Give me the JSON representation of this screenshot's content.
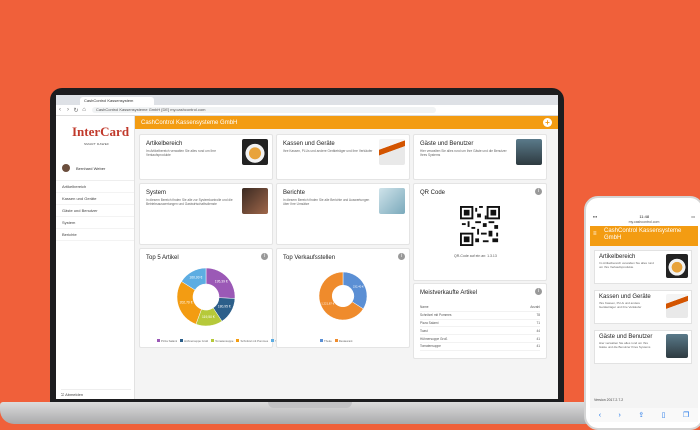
{
  "browser": {
    "tab_title": "CashControl Kassensystem",
    "url": "CashControl Kassensysteme GmbH [DE]   my.cashcontrol.com"
  },
  "sidebar": {
    "logo_main": "InterCard",
    "logo_sub": "SMART DAWEF",
    "user_name": "Bernhard Weber",
    "items": [
      {
        "label": "Artikelbereich"
      },
      {
        "label": "Kassen und Geräte"
      },
      {
        "label": "Gäste und Benutzer"
      },
      {
        "label": "System"
      },
      {
        "label": "Berichte"
      }
    ],
    "logout": "Abmelden"
  },
  "header": {
    "title": "CashControl Kassensysteme GmbH",
    "add": "+"
  },
  "cards": [
    {
      "title": "Artikelbereich",
      "text": "Im Artikelbereich verwalten Sie alles rund um Ihre Verkaufsprodukte"
    },
    {
      "title": "Kassen und Geräte",
      "text": "Ihre Kassen, PLUs und andere Geräteträger und ihre Verkäufer"
    },
    {
      "title": "Gäste und Benutzer",
      "text": "Hier verwalten Sie alles rund um Ihre Gäste und die Benutzer Ihres Systems"
    },
    {
      "title": "System",
      "text": "In diesem Bereich finden Sie alle zur Systemkontrolle und die Betriebsauswertungen und Gastwirtschaftsdienste"
    },
    {
      "title": "Berichte",
      "text": "In diesem Bereich finden Sie alle Berichte und Auswertungen über Ihre Umsätze"
    }
  ],
  "qr_card": {
    "title": "QR Code",
    "caption": "QR-Code auf ein an: 1.3.13"
  },
  "chart1": {
    "title": "Top 5 Artikel"
  },
  "chart2": {
    "title": "Top Verkaufsstellen"
  },
  "bestsellers": {
    "title": "Meistverkaufte Artikel",
    "headers": [
      "Name",
      "Anzahl"
    ],
    "rows": [
      [
        "Schnitzel mit Pommes",
        "78"
      ],
      [
        "Pizza Salami",
        "71"
      ],
      [
        "Toast",
        "44"
      ],
      [
        "Hühnersuppe Groß",
        "41"
      ],
      [
        "Tomatensuppe",
        "41"
      ]
    ]
  },
  "chart_data": [
    {
      "type": "pie",
      "title": "Top 5 Artikel",
      "categories": [
        "Pizza Salami",
        "Hühnersuppe Groß",
        "Tomatensuppe",
        "Schnitzel mit Pommes",
        "Toast"
      ],
      "values": [
        71,
        41,
        41,
        78,
        44
      ],
      "data_labels": [
        "195,39 €",
        "180,95 €",
        "119,50 €",
        "202,70 €",
        "160,00 €"
      ],
      "colors": [
        "#9b59b6",
        "#2c5f8a",
        "#b6c93a",
        "#f39c12",
        "#5dade2"
      ]
    },
    {
      "type": "pie",
      "title": "Top Verkaufsstellen",
      "categories": [
        "Theke",
        "Restaurant"
      ],
      "values": [
        34,
        66
      ],
      "data_labels": [
        "232,40 €",
        "1.221,87 €"
      ],
      "colors": [
        "#5b8fd4",
        "#ef8b2c"
      ]
    }
  ],
  "phone": {
    "time": "11:48",
    "url": "my.cashcontrol.com",
    "header": "CashControl Kassensysteme GmbH",
    "cards": [
      {
        "title": "Artikelbereich",
        "text": "Im Artikelbereich verwalten Sie alles rund um Ihre Verkaufsprodukte"
      },
      {
        "title": "Kassen und Geräte",
        "text": "Ihre Kassen, PLUs und andere Geräteträger und ihre Verkäufer"
      },
      {
        "title": "Gäste und Benutzer",
        "text": "Hier verwalten Sie alles rund um Ihre Gäste und die Benutzer Ihres Systems"
      }
    ],
    "version": "Version 2017.2.7.2"
  }
}
